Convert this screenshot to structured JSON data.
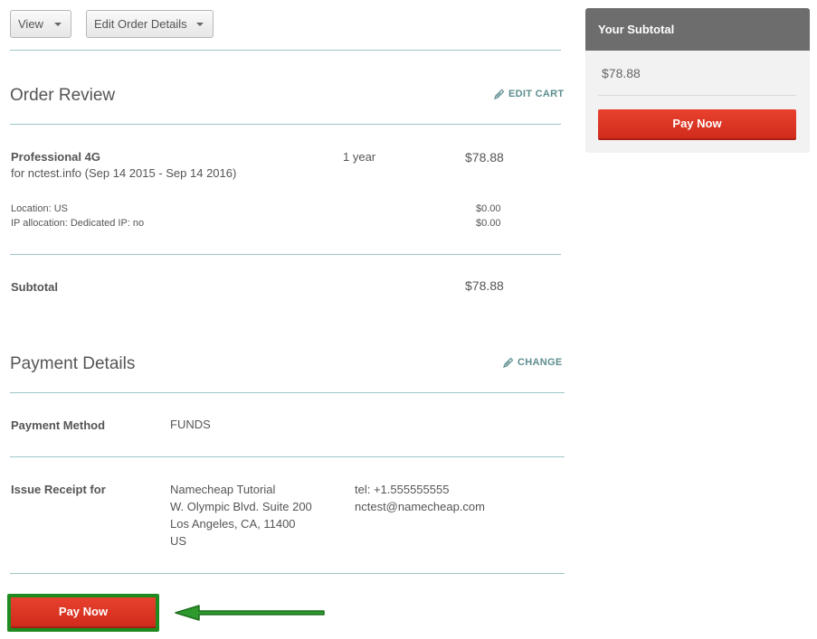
{
  "toolbar": {
    "view_label": "View",
    "edit_order_label": "Edit Order Details"
  },
  "order_review": {
    "title": "Order Review",
    "edit_cart_label": "EDIT CART",
    "item": {
      "name": "Professional 4G",
      "detail": "for nctest.info (Sep 14 2015 - Sep 14 2016)",
      "term": "1 year",
      "price": "$78.88"
    },
    "options": [
      {
        "label": "Location: US",
        "price": "$0.00"
      },
      {
        "label": "IP allocation: Dedicated IP: no",
        "price": "$0.00"
      }
    ],
    "subtotal_label": "Subtotal",
    "subtotal_value": "$78.88"
  },
  "payment_details": {
    "title": "Payment Details",
    "change_label": "CHANGE",
    "method_label": "Payment Method",
    "method_value": "FUNDS",
    "receipt_label": "Issue Receipt for",
    "address": [
      "Namecheap Tutorial",
      "W. Olympic Blvd. Suite 200",
      "Los Angeles, CA,  11400",
      "US"
    ],
    "contact": [
      "tel: +1.555555555",
      "nctest@namecheap.com"
    ]
  },
  "pay_now_label": "Pay Now",
  "sidebar": {
    "title": "Your Subtotal",
    "amount": "$78.88",
    "pay_now_label": "Pay Now"
  },
  "icons": {
    "pencil": "pencil-icon",
    "caret": "caret-down-icon",
    "arrow": "arrow-left-icon"
  },
  "colors": {
    "accent_teal": "#5d8d8e",
    "button_red": "#d9321f",
    "highlight_green": "#1f8a1f"
  }
}
